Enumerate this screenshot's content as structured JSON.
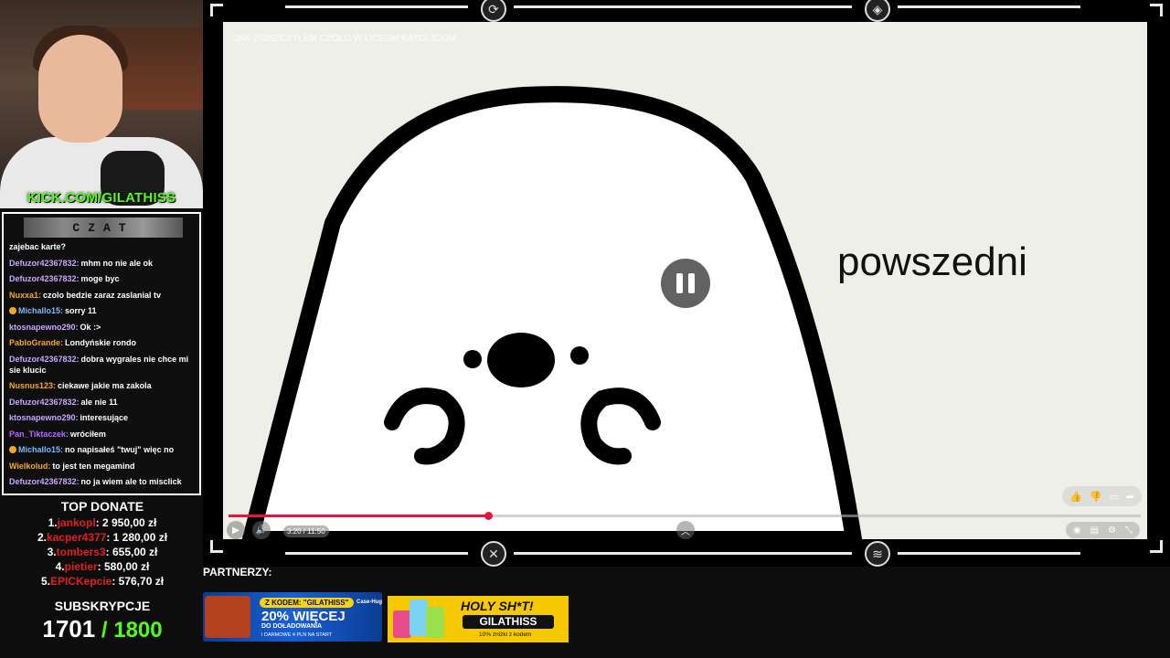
{
  "stream": {
    "kick_url": "KICK.COM/GILATHISS",
    "chat_title": "CZAT"
  },
  "chat": [
    {
      "user": "",
      "text": "zajebac karte?",
      "color": "#ffffff",
      "badge": false
    },
    {
      "user": "Defuzor42367832:",
      "text": "mhm no nie ale ok",
      "color": "#c9a7ff",
      "badge": false
    },
    {
      "user": "Defuzor42367832:",
      "text": "moge byc",
      "color": "#c9a7ff",
      "badge": false
    },
    {
      "user": "Nuxxa1:",
      "text": "czolo bedzie zaraz zaslanial tv",
      "color": "#f5a623",
      "badge": false
    },
    {
      "user": "Michallo15:",
      "text": "sorry 11",
      "color": "#7ab8ff",
      "badge": true
    },
    {
      "user": "ktosnapewno290:",
      "text": "Ok :>",
      "color": "#c9a7ff",
      "badge": false
    },
    {
      "user": "PabloGrande:",
      "text": "Londyńskie rondo",
      "color": "#f5a623",
      "badge": false
    },
    {
      "user": "Defuzor42367832:",
      "text": "dobra wygrales nie chce mi sie klucic",
      "color": "#c9a7ff",
      "badge": false
    },
    {
      "user": "Nusnus123:",
      "text": "ciekawe jakie ma zakola",
      "color": "#f5a623",
      "badge": false
    },
    {
      "user": "Defuzor42367832:",
      "text": "ale nie 11",
      "color": "#c9a7ff",
      "badge": false
    },
    {
      "user": "ktosnapewno290:",
      "text": "interesujące",
      "color": "#c9a7ff",
      "badge": false
    },
    {
      "user": "Pan_Tiktaczek:",
      "text": "wróciłem",
      "color": "#b36bff",
      "badge": false
    },
    {
      "user": "Michallo15:",
      "text": "no napisałeś \"twuj\" więc no",
      "color": "#7ab8ff",
      "badge": true
    },
    {
      "user": "Wielkolud:",
      "text": "to jest ten megamind",
      "color": "#f5a623",
      "badge": false
    },
    {
      "user": "Defuzor42367832:",
      "text": "no ja wiem ale to misclick",
      "color": "#c9a7ff",
      "badge": false
    }
  ],
  "top_donate": {
    "title": "TOP DONATE",
    "items": [
      {
        "rank": "1.",
        "name": "jankopl",
        "amount": ": 2 950,00 zł"
      },
      {
        "rank": "2.",
        "name": "kacper4377",
        "amount": ": 1 280,00 zł"
      },
      {
        "rank": "3.",
        "name": "tombers3",
        "amount": ": 655,00 zł"
      },
      {
        "rank": "4.",
        "name": "pietier",
        "amount": ": 580,00 zł"
      },
      {
        "rank": "5.",
        "name": "EPICKepcie",
        "amount": ": 576,70 zł"
      }
    ]
  },
  "subs": {
    "title": "SUBSKRYPCJE",
    "current": "1701",
    "goal": " / 1800"
  },
  "video": {
    "title": "JAK ZNISZCZYŁEM CZOŁO W LICEUM KATOLICKIM",
    "overlay_text": "powszedni",
    "time": "3:20 / 11:50",
    "progress": 0.285
  },
  "partners": {
    "label": "PARTNERZY:",
    "p1": {
      "code": "Z KODEM: \"GILATHISS\"",
      "main": "20% WIĘCEJ",
      "sub": "DO DOŁADOWANIA",
      "small": "I DARMOWE 4 PLN NA START",
      "brand": "Case-Hug"
    },
    "p2": {
      "title": "HOLY SH*T!",
      "name": "GILATHISS",
      "sub": "10% zniżki z kodem"
    }
  },
  "colors": {
    "kick_green": "#53fc18",
    "donor_red": "#e0201f",
    "progress_red": "#e3173e"
  }
}
